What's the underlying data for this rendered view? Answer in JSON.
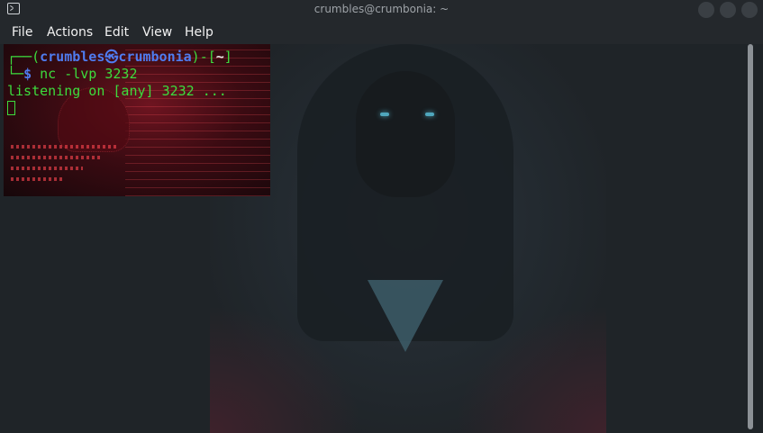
{
  "window": {
    "title": "crumbles@crumbonia: ~",
    "app_icon": "terminal-icon"
  },
  "menu": {
    "items": [
      "File",
      "Actions",
      "Edit",
      "View",
      "Help"
    ]
  },
  "prompt": {
    "corner_top": "┌──(",
    "user": "crumbles",
    "at_symbol": "㉿",
    "host": "crumbonia",
    "close_user_host": ")-[",
    "cwd": "~",
    "close_cwd": "]",
    "corner_bottom": "└─",
    "dollar": "$",
    "command": "nc -lvp 3232"
  },
  "output": {
    "line1": "listening on [any] 3232 ..."
  },
  "colors": {
    "prompt_green": "#3ddc3d",
    "prompt_blue": "#4f7cf0",
    "background": "#1f2428"
  }
}
